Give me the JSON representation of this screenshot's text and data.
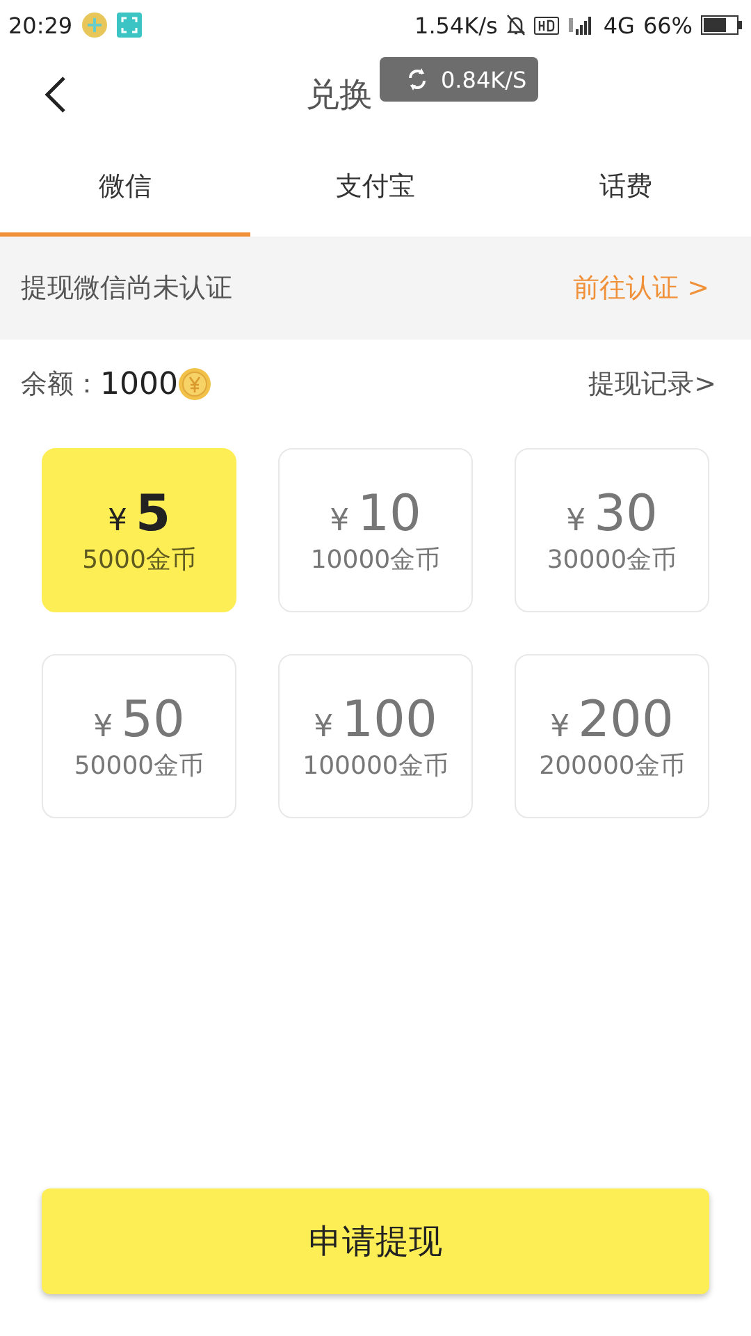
{
  "status_bar": {
    "time": "20:29",
    "speed": "1.54K/s",
    "network": "4G",
    "battery": "66%"
  },
  "toast": {
    "text": "0.84K/S"
  },
  "header": {
    "title": "兑换"
  },
  "tabs": [
    {
      "label": "微信",
      "selected": true
    },
    {
      "label": "支付宝",
      "selected": false
    },
    {
      "label": "话费",
      "selected": false
    }
  ],
  "notice": {
    "text": "提现微信尚未认证",
    "link": "前往认证 >"
  },
  "balance": {
    "label": "余额：",
    "value": "1000",
    "history_link": "提现记录>"
  },
  "options": [
    {
      "currency": "¥",
      "amount": "5",
      "coins": "5000金币",
      "selected": true
    },
    {
      "currency": "¥",
      "amount": "10",
      "coins": "10000金币",
      "selected": false
    },
    {
      "currency": "¥",
      "amount": "30",
      "coins": "30000金币",
      "selected": false
    },
    {
      "currency": "¥",
      "amount": "50",
      "coins": "50000金币",
      "selected": false
    },
    {
      "currency": "¥",
      "amount": "100",
      "coins": "100000金币",
      "selected": false
    },
    {
      "currency": "¥",
      "amount": "200",
      "coins": "200000金币",
      "selected": false
    }
  ],
  "submit_button": "申请提现"
}
